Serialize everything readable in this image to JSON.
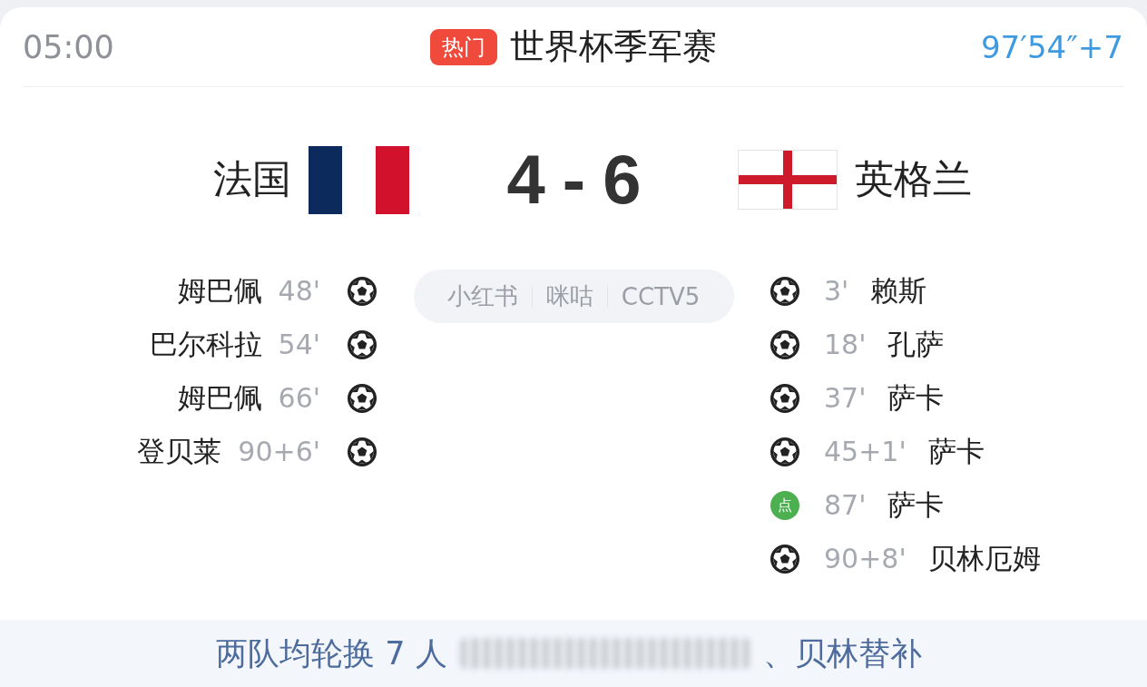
{
  "header": {
    "time": "05:00",
    "badge": "热门",
    "title": "世界杯季军赛",
    "clock": "97′54″+7"
  },
  "teams": [
    {
      "name": "法国",
      "kind": "tricolor"
    },
    {
      "name": "英格兰",
      "kind": "cross"
    }
  ],
  "score": "4 - 6",
  "broadcasters": [
    "小红书",
    "咪咕",
    "CCTV5"
  ],
  "home_goals": [
    {
      "player": "姆巴佩",
      "minute": "48'",
      "kind": "goal"
    },
    {
      "player": "巴尔科拉",
      "minute": "54'",
      "kind": "goal"
    },
    {
      "player": "姆巴佩",
      "minute": "66'",
      "kind": "goal"
    },
    {
      "player": "登贝莱",
      "minute": "90+6'",
      "kind": "goal"
    }
  ],
  "away_goals": [
    {
      "player": "赖斯",
      "minute": "3'",
      "kind": "goal"
    },
    {
      "player": "孔萨",
      "minute": "18'",
      "kind": "goal"
    },
    {
      "player": "萨卡",
      "minute": "37'",
      "kind": "goal"
    },
    {
      "player": "萨卡",
      "minute": "45+1'",
      "kind": "goal"
    },
    {
      "player": "萨卡",
      "minute": "87'",
      "kind": "penalty",
      "mark": "点"
    },
    {
      "player": "贝林厄姆",
      "minute": "90+8'",
      "kind": "goal"
    }
  ],
  "summary": {
    "before": "两队均轮换 7 人",
    "after": "、贝林替补"
  }
}
